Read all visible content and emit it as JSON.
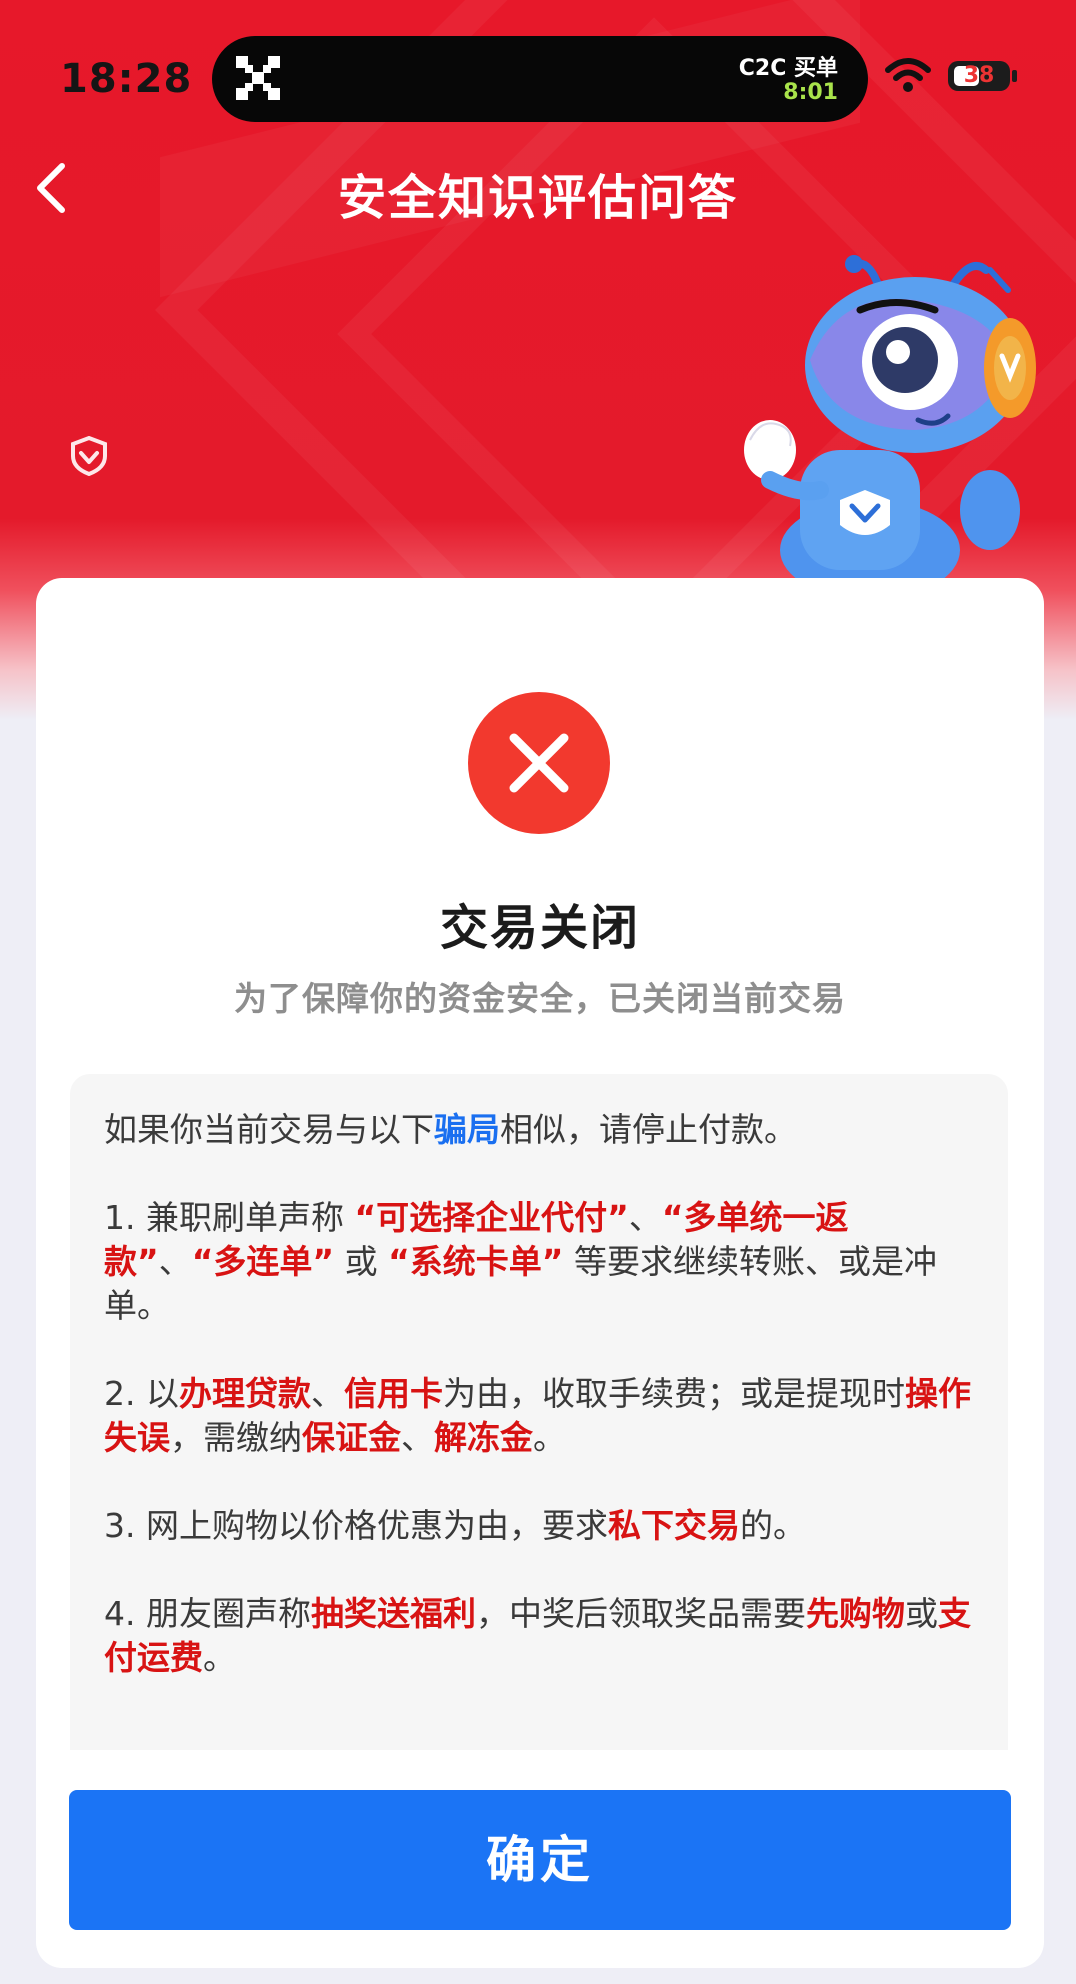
{
  "status_bar": {
    "time": "18:28",
    "island_title": "C2C 买单",
    "island_timer": "8:01",
    "battery": "38"
  },
  "header": {
    "title": "安全知识评估问答"
  },
  "result": {
    "title": "交易关闭",
    "subtitle": "为了保障你的资金安全，已关闭当前交易"
  },
  "notice": {
    "intro": [
      {
        "text": "如果你当前交易与以下",
        "style": "normal"
      },
      {
        "text": "骗局",
        "style": "blue"
      },
      {
        "text": "相似，请停止付款。",
        "style": "normal"
      }
    ],
    "items": [
      [
        {
          "text": "1. 兼职刷单声称 ",
          "style": "normal"
        },
        {
          "text": "“可选择企业代付”",
          "style": "red"
        },
        {
          "text": "、",
          "style": "normal"
        },
        {
          "text": "“多单统一返款”",
          "style": "red"
        },
        {
          "text": "、",
          "style": "normal"
        },
        {
          "text": "“多连单”",
          "style": "red"
        },
        {
          "text": " 或 ",
          "style": "normal"
        },
        {
          "text": "“系统卡单”",
          "style": "red"
        },
        {
          "text": " 等要求继续转账、或是冲单。",
          "style": "normal"
        }
      ],
      [
        {
          "text": "2. 以",
          "style": "normal"
        },
        {
          "text": "办理贷款",
          "style": "red"
        },
        {
          "text": "、",
          "style": "normal"
        },
        {
          "text": "信用卡",
          "style": "red"
        },
        {
          "text": "为由，收取手续费；或是提现时",
          "style": "normal"
        },
        {
          "text": "操作失误",
          "style": "red"
        },
        {
          "text": "，需缴纳",
          "style": "normal"
        },
        {
          "text": "保证金",
          "style": "red"
        },
        {
          "text": "、",
          "style": "normal"
        },
        {
          "text": "解冻金",
          "style": "red"
        },
        {
          "text": "。",
          "style": "normal"
        }
      ],
      [
        {
          "text": "3. 网上购物以价格优惠为由，要求",
          "style": "normal"
        },
        {
          "text": "私下交易",
          "style": "red"
        },
        {
          "text": "的。",
          "style": "normal"
        }
      ],
      [
        {
          "text": "4. 朋友圈声称",
          "style": "normal"
        },
        {
          "text": "抽奖送福利",
          "style": "red"
        },
        {
          "text": "，中奖后领取奖品需要",
          "style": "normal"
        },
        {
          "text": "先购物",
          "style": "red"
        },
        {
          "text": "或",
          "style": "normal"
        },
        {
          "text": "支付运费",
          "style": "red"
        },
        {
          "text": "。",
          "style": "normal"
        }
      ]
    ]
  },
  "actions": {
    "confirm_label": "确定"
  },
  "icons": {
    "back": "chevron-left-icon",
    "shield": "shield-icon",
    "close": "close-icon",
    "wifi": "wifi-icon"
  },
  "colors": {
    "header_red": "#e7182a",
    "error_red": "#f2392e",
    "highlight_red": "#d81313",
    "link_blue": "#1a6ff0",
    "button_blue": "#1b74f5"
  }
}
